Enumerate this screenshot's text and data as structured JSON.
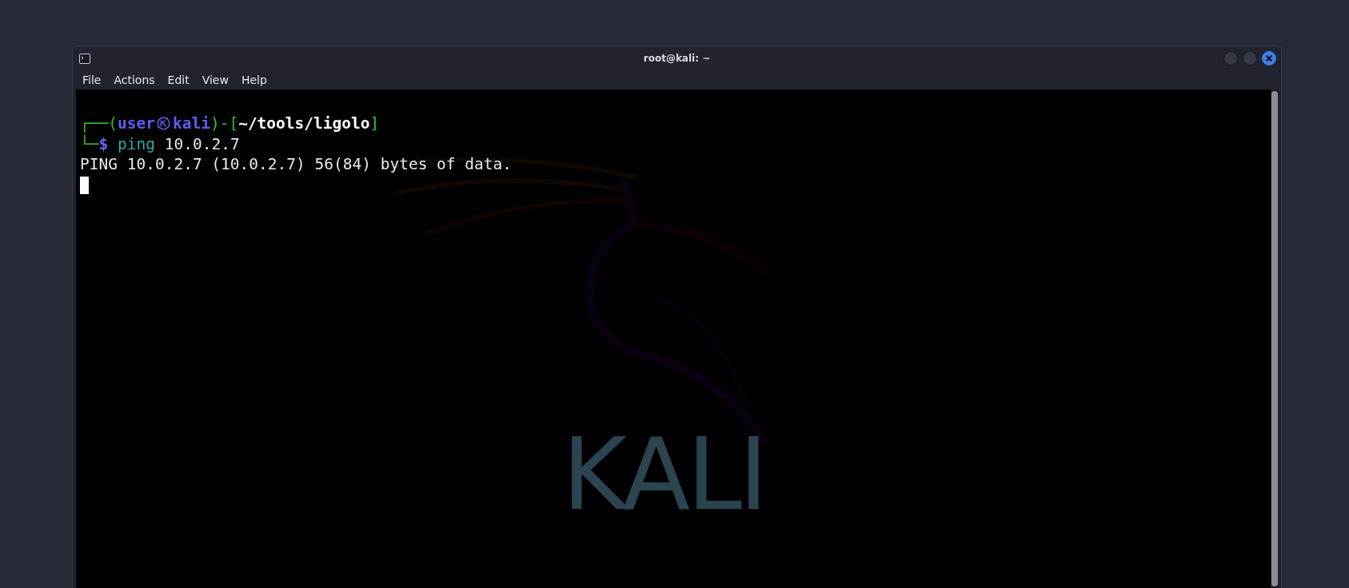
{
  "window": {
    "title": "root@kali: ~"
  },
  "menu": [
    "File",
    "Actions",
    "Edit",
    "View",
    "Help"
  ],
  "terminal": {
    "prompt": {
      "frame_open": "┌──(",
      "user": "user",
      "host": "kali",
      "frame_mid": ")-[",
      "cwd": "~/tools/ligolo",
      "frame_close": "]",
      "frame_bottom": "└─",
      "symbol": "$"
    },
    "command": {
      "program": "ping",
      "args": "10.0.2.7"
    },
    "output": [
      "PING 10.0.2.7 (10.0.2.7) 56(84) bytes of data."
    ],
    "cursor_visible": true,
    "background_logo_text": "KALI"
  }
}
